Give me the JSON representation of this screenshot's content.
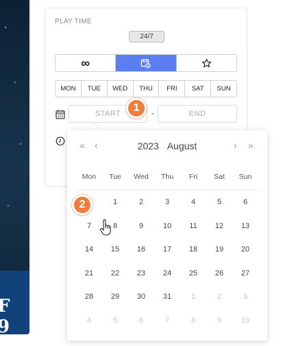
{
  "background": {
    "text": "F 9"
  },
  "play_time": {
    "section_title": "PLAY TIME",
    "badge": "24/7",
    "mode_tabs": [
      {
        "icon": "infinity-icon",
        "glyph": "∞",
        "active": false
      },
      {
        "icon": "calendar-clock-icon",
        "glyph": "",
        "active": true
      },
      {
        "icon": "star-icon",
        "glyph": "☆",
        "active": false
      }
    ],
    "days": [
      "MON",
      "TUE",
      "WED",
      "THU",
      "FRI",
      "SAT",
      "SUN"
    ],
    "date_range": {
      "start_placeholder": "START",
      "separator": "-",
      "end_placeholder": "END"
    }
  },
  "markers": {
    "step1": "1",
    "step2": "2"
  },
  "calendar": {
    "prev_year": "«",
    "prev_month": "‹",
    "next_month": "›",
    "next_year": "»",
    "year": "2023",
    "month": "August",
    "weekdays": [
      "Mon",
      "Tue",
      "Wed",
      "Thu",
      "Fri",
      "Sat",
      "Sun"
    ],
    "weeks": [
      [
        {
          "d": "31",
          "m": true
        },
        {
          "d": "1"
        },
        {
          "d": "2"
        },
        {
          "d": "3"
        },
        {
          "d": "4"
        },
        {
          "d": "5"
        },
        {
          "d": "6"
        }
      ],
      [
        {
          "d": "7"
        },
        {
          "d": "8"
        },
        {
          "d": "9"
        },
        {
          "d": "10"
        },
        {
          "d": "11"
        },
        {
          "d": "12"
        },
        {
          "d": "13"
        }
      ],
      [
        {
          "d": "14"
        },
        {
          "d": "15"
        },
        {
          "d": "16"
        },
        {
          "d": "17"
        },
        {
          "d": "18"
        },
        {
          "d": "19"
        },
        {
          "d": "20"
        }
      ],
      [
        {
          "d": "21"
        },
        {
          "d": "22"
        },
        {
          "d": "23"
        },
        {
          "d": "24"
        },
        {
          "d": "25"
        },
        {
          "d": "26"
        },
        {
          "d": "27"
        }
      ],
      [
        {
          "d": "28"
        },
        {
          "d": "29"
        },
        {
          "d": "30"
        },
        {
          "d": "31"
        },
        {
          "d": "1",
          "m": true
        },
        {
          "d": "2",
          "m": true
        },
        {
          "d": "3",
          "m": true
        }
      ],
      [
        {
          "d": "4",
          "m": true
        },
        {
          "d": "5",
          "m": true
        },
        {
          "d": "6",
          "m": true
        },
        {
          "d": "7",
          "m": true
        },
        {
          "d": "8",
          "m": true
        },
        {
          "d": "9",
          "m": true
        },
        {
          "d": "10",
          "m": true
        }
      ]
    ]
  },
  "colors": {
    "accent": "#5b7ff3",
    "marker": "#ef7d3c"
  }
}
